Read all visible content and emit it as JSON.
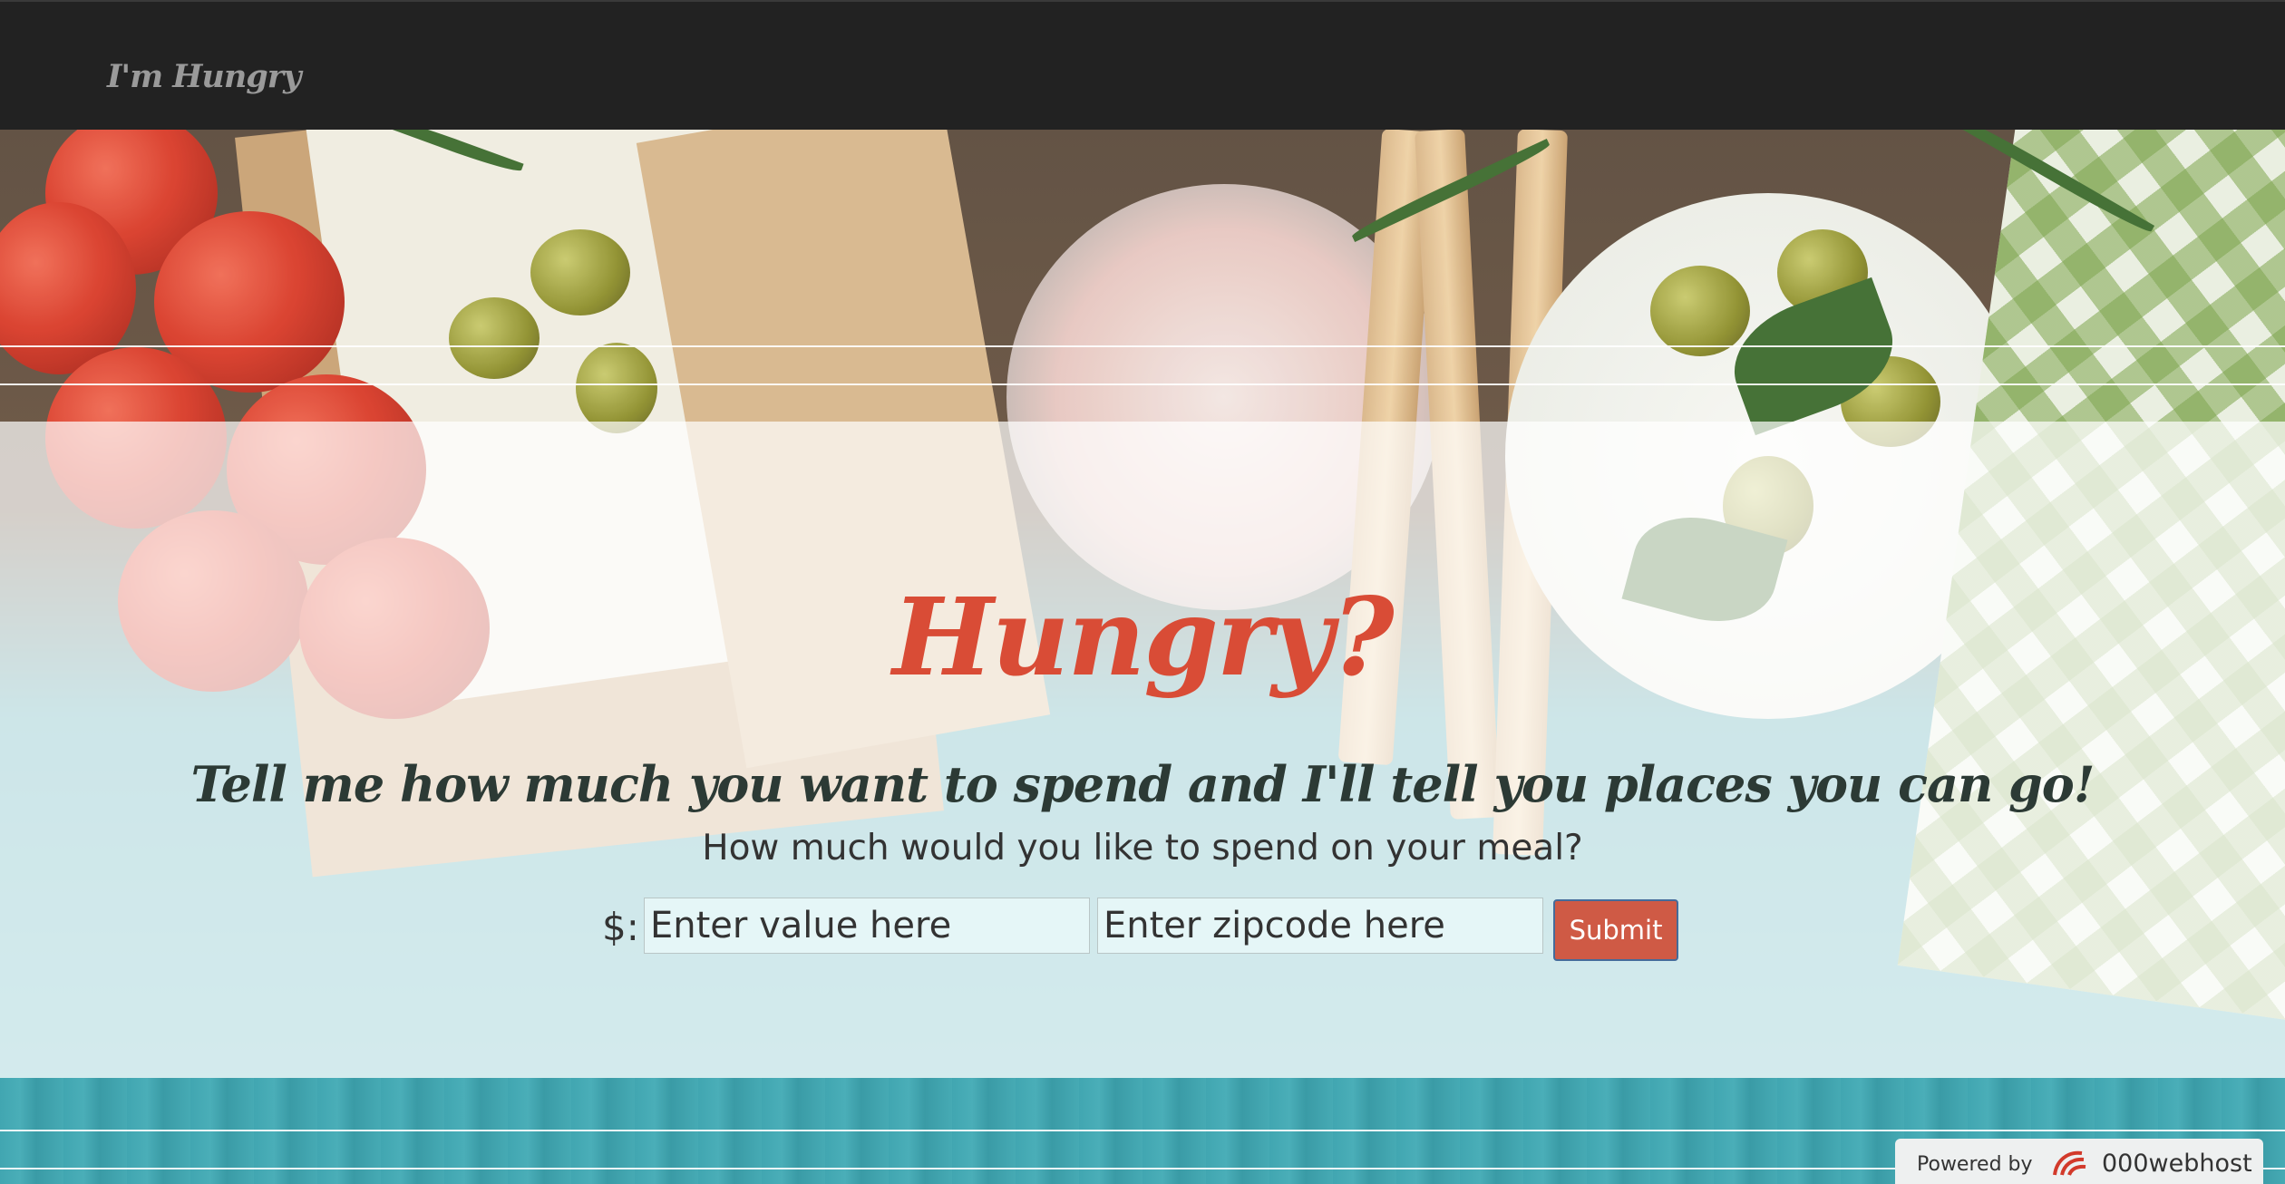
{
  "navbar": {
    "brand": "I'm Hungry"
  },
  "hero": {
    "headline": "Hungry?",
    "tagline": "Tell me how much you want to spend and I'll tell you places you can go!",
    "question": "How much would you like to spend on your meal?"
  },
  "form": {
    "currency_label": "$:",
    "value_placeholder": "Enter value here",
    "zip_placeholder": "Enter zipcode here",
    "submit_label": "Submit"
  },
  "badge": {
    "powered_by": "Powered by",
    "host_name": "000webhost",
    "icon": "000webhost-logo-icon"
  },
  "colors": {
    "navbar": "#222222",
    "headline": "#d94c36",
    "submit": "#cf5a45"
  }
}
